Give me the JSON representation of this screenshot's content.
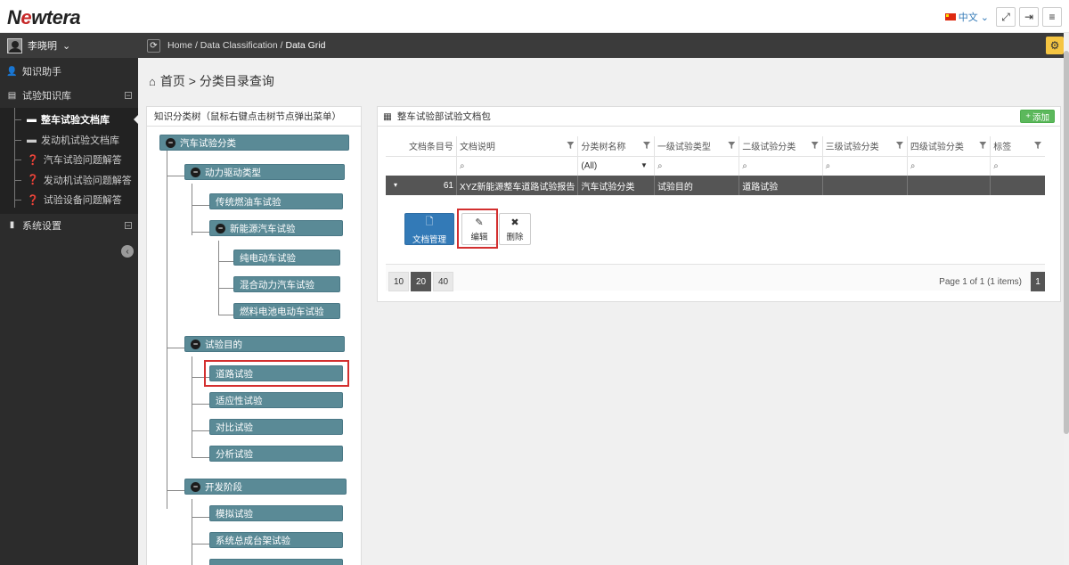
{
  "app": {
    "logo_pre": "N",
    "logo_o": "e",
    "logo_post": "wtera"
  },
  "topbar": {
    "language": "中文",
    "fullscreen_icon": "expand-icon",
    "logout_icon": "logout-icon",
    "menu_icon": "menu-icon"
  },
  "sidebar": {
    "user_name": "李晓明",
    "items": [
      {
        "label": "知识助手",
        "icon": "user-icon"
      },
      {
        "label": "试验知识库",
        "icon": "list-icon",
        "expanded": true
      },
      {
        "label": "系统设置",
        "icon": "book-icon"
      }
    ],
    "sub_items": [
      {
        "label": "整车试验文档库",
        "icon": "list-icon",
        "active": true
      },
      {
        "label": "发动机试验文档库",
        "icon": "list-icon"
      },
      {
        "label": "汽车试验问题解答",
        "icon": "question-icon"
      },
      {
        "label": "发动机试验问题解答",
        "icon": "question-icon"
      },
      {
        "label": "试验设备问题解答",
        "icon": "question-icon"
      }
    ]
  },
  "breadcrumb": {
    "home": "Home",
    "sep": "/",
    "level1": "Data Classification",
    "current": "Data Grid"
  },
  "page_title": "首页 > 分类目录查询",
  "tree": {
    "header": "知识分类树（鼠标右键点击树节点弹出菜单）",
    "root": "汽车试验分类",
    "n_drive": "动力驱动类型",
    "n_fuel": "传统燃油车试验",
    "n_new_energy": "新能源汽车试验",
    "n_ev": "纯电动车试验",
    "n_hybrid": "混合动力汽车试验",
    "n_fcev": "燃料电池电动车试验",
    "n_purpose": "试验目的",
    "n_road": "道路试验",
    "n_adapt": "适应性试验",
    "n_compare": "对比试验",
    "n_analysis": "分析试验",
    "n_stage": "开发阶段",
    "n_sim": "模拟试验",
    "n_bench": "系统总成台架试验"
  },
  "grid": {
    "title": "整车试验部试验文档包",
    "add_label": "添加",
    "columns": [
      "文档条目号",
      "文档说明",
      "分类树名称",
      "一级试验类型",
      "二级试验分类",
      "三级试验分类",
      "四级试验分类",
      "标签"
    ],
    "filter_all": "(All)",
    "row": {
      "id": "61",
      "desc": "XYZ新能源整车道路试验报告",
      "tree": "汽车试验分类",
      "l1": "试验目的",
      "l2": "道路试验",
      "l3": "",
      "l4": "",
      "tag": ""
    },
    "actions": {
      "doc_manage": "文档管理",
      "edit": "编辑",
      "delete": "删除"
    },
    "page_sizes": [
      "10",
      "20",
      "40"
    ],
    "page_size_selected": "20",
    "page_info": "Page 1 of 1 (1 items)",
    "current_page": "1"
  }
}
